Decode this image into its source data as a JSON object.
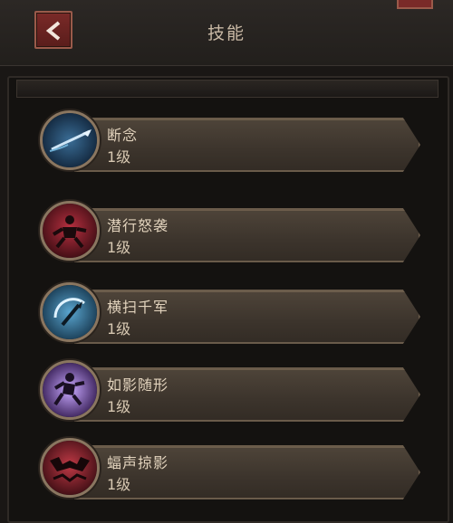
{
  "header": {
    "title": "技能"
  },
  "skills": [
    {
      "name": "断念",
      "level": "1级",
      "icon": "dagger-icon",
      "color": "#1b3a5a"
    },
    {
      "name": "潜行怒袭",
      "level": "1级",
      "icon": "ninja-icon",
      "color": "#6a1a22"
    },
    {
      "name": "横扫千军",
      "level": "1级",
      "icon": "slash-icon",
      "color": "#1a4a6a"
    },
    {
      "name": "如影随形",
      "level": "1级",
      "icon": "shadow-runner-icon",
      "color": "#4a2a7a"
    },
    {
      "name": "蝠声掠影",
      "level": "1级",
      "icon": "bat-icon",
      "color": "#6a1a22"
    }
  ]
}
